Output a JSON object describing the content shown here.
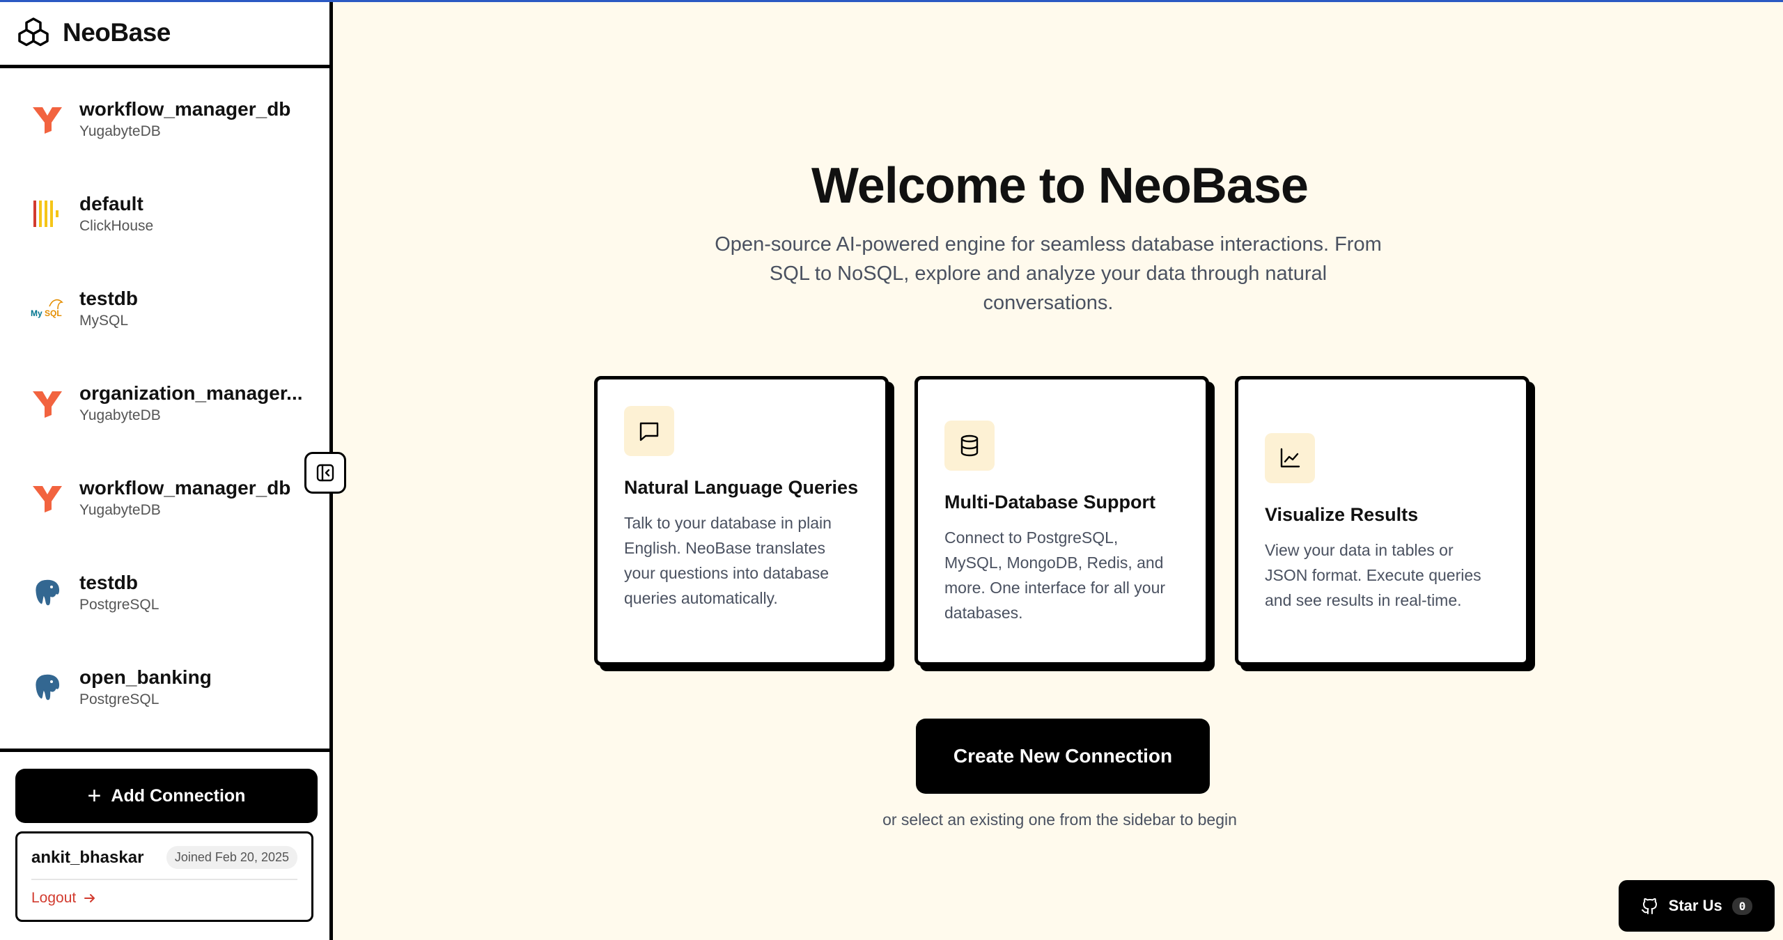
{
  "app": {
    "title": "NeoBase"
  },
  "sidebar": {
    "connections": [
      {
        "name": "workflow_manager_db",
        "type": "YugabyteDB",
        "icon": "yugabyte-icon"
      },
      {
        "name": "default",
        "type": "ClickHouse",
        "icon": "clickhouse-icon"
      },
      {
        "name": "testdb",
        "type": "MySQL",
        "icon": "mysql-icon"
      },
      {
        "name": "organization_manager...",
        "type": "YugabyteDB",
        "icon": "yugabyte-icon"
      },
      {
        "name": "workflow_manager_db",
        "type": "YugabyteDB",
        "icon": "yugabyte-icon"
      },
      {
        "name": "testdb",
        "type": "PostgreSQL",
        "icon": "postgresql-icon"
      },
      {
        "name": "open_banking",
        "type": "PostgreSQL",
        "icon": "postgresql-icon"
      }
    ],
    "add_connection_label": "Add Connection",
    "user": {
      "username": "ankit_bhaskar",
      "joined": "Joined Feb 20, 2025",
      "logout_label": "Logout"
    }
  },
  "main": {
    "title": "Welcome to NeoBase",
    "subtitle": "Open-source AI-powered engine for seamless database interactions. From SQL to NoSQL, explore and analyze your data through natural conversations.",
    "features": [
      {
        "title": "Natural Language Queries",
        "description": "Talk to your database in plain English. NeoBase translates your questions into database queries automatically.",
        "icon": "chat-bubble-icon"
      },
      {
        "title": "Multi-Database Support",
        "description": "Connect to PostgreSQL, MySQL, MongoDB, Redis, and more. One interface for all your databases.",
        "icon": "database-icon"
      },
      {
        "title": "Visualize Results",
        "description": "View your data in tables or JSON format. Execute queries and see results in real-time.",
        "icon": "line-chart-icon"
      }
    ],
    "create_button_label": "Create New Connection",
    "hint": "or select an existing one from the sidebar to begin"
  },
  "star": {
    "label": "Star Us",
    "count": "0"
  },
  "colors": {
    "accent": "#000000",
    "background": "#fffaed",
    "logout": "#d23b2f",
    "yugabyte": "#f2633f",
    "clickhouse": "#f5c518",
    "postgres": "#336791"
  }
}
